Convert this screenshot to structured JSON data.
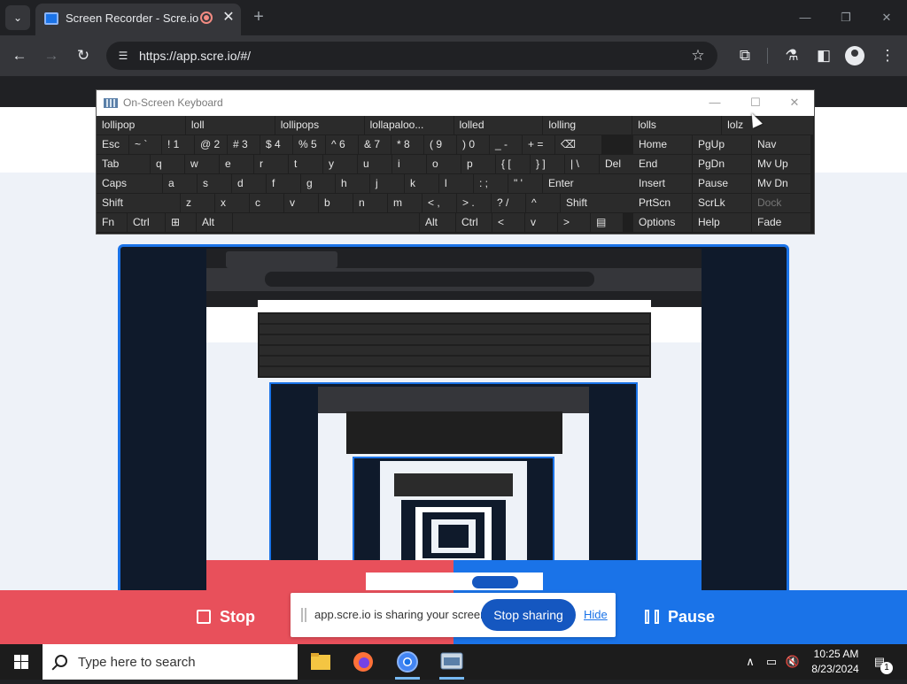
{
  "browser": {
    "tab_title": "Screen Recorder - Scre.io",
    "url": "https://app.scre.io/#/",
    "icons": {
      "tab_menu": "chevron-down-icon",
      "new_tab": "plus-icon",
      "minimize": "minimize-icon",
      "restore": "restore-icon",
      "close": "close-icon",
      "back": "arrow-left-icon",
      "forward": "arrow-right-icon",
      "reload": "reload-icon",
      "site_info": "tune-icon",
      "bookmark": "star-icon",
      "extensions": "puzzle-icon",
      "labs": "flask-icon",
      "side_panel": "side-panel-icon",
      "profile": "avatar-icon",
      "menu": "kebab-menu-icon"
    }
  },
  "osk": {
    "title": "On-Screen Keyboard",
    "suggestions": [
      "lollipop",
      "loll",
      "lollipops",
      "lollapaloo...",
      "lolled",
      "lolling",
      "lolls",
      "lolz"
    ],
    "rows": [
      [
        "Esc",
        "~ `",
        "! 1",
        "@ 2",
        "# 3",
        "$ 4",
        "% 5",
        "^ 6",
        "& 7",
        "* 8",
        "( 9",
        ") 0",
        "_ -",
        "+ =",
        "⌫"
      ],
      [
        "Tab",
        "q",
        "w",
        "e",
        "r",
        "t",
        "y",
        "u",
        "i",
        "o",
        "p",
        "{ [",
        "} ]",
        "| \\",
        "Del"
      ],
      [
        "Caps",
        "a",
        "s",
        "d",
        "f",
        "g",
        "h",
        "j",
        "k",
        "l",
        ": ;",
        "\" '",
        "Enter"
      ],
      [
        "Shift",
        "z",
        "x",
        "c",
        "v",
        "b",
        "n",
        "m",
        "< ,",
        "> .",
        "? /",
        "^",
        "Shift"
      ],
      [
        "Fn",
        "Ctrl",
        "⊞",
        "Alt",
        "",
        "Alt",
        "Ctrl",
        "<",
        "v",
        ">",
        "▤"
      ]
    ],
    "nav_rows": [
      [
        "Home",
        "PgUp",
        "Nav"
      ],
      [
        "End",
        "PgDn",
        "Mv Up"
      ],
      [
        "Insert",
        "Pause",
        "Mv Dn"
      ],
      [
        "PrtScn",
        "ScrLk",
        "Dock"
      ],
      [
        "Options",
        "Help",
        "Fade"
      ]
    ]
  },
  "sharing": {
    "stop_label": "Stop",
    "pause_label": "Pause",
    "notice_text": "app.scre.io is sharing your screen.",
    "stop_sharing_label": "Stop sharing",
    "hide_label": "Hide",
    "colors": {
      "stop": "#e8505b",
      "pause": "#1a73e8",
      "button": "#1557c0"
    }
  },
  "taskbar": {
    "search_placeholder": "Type here to search",
    "time": "10:25 AM",
    "date": "8/23/2024",
    "notification_count": "1",
    "apps": [
      "file-explorer-icon",
      "firefox-icon",
      "chrome-icon",
      "on-screen-keyboard-icon"
    ],
    "tray_icons": [
      "chevron-up-icon",
      "network-icon",
      "volume-muted-icon",
      "notification-icon"
    ]
  }
}
